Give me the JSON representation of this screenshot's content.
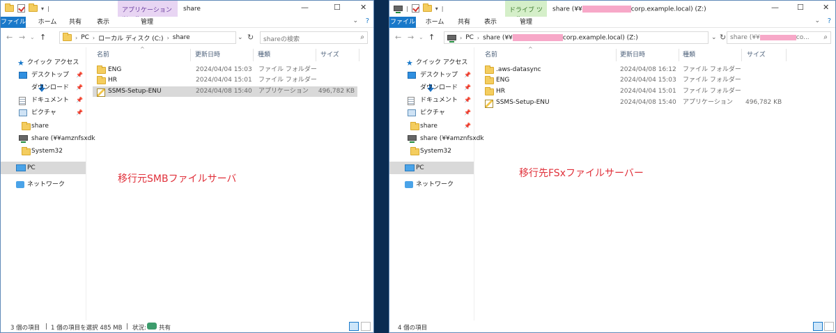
{
  "left": {
    "ribbon_tabs": [
      "ファイル",
      "ホーム",
      "共有",
      "表示",
      "管理"
    ],
    "context_tab": "アプリケーション ツール",
    "title": "share",
    "path": [
      "PC",
      "ローカル ディスク (C:)",
      "share"
    ],
    "search_placeholder": "shareの検索",
    "nav": {
      "quick_access": "クイック アクセス",
      "items": [
        "デスクトップ",
        "ダウンロード",
        "ドキュメント",
        "ピクチャ",
        "share",
        "share (¥¥amznfsxdk",
        "System32"
      ],
      "pc": "PC",
      "network": "ネットワーク"
    },
    "columns": [
      "名前",
      "更新日時",
      "種類",
      "サイズ"
    ],
    "files": [
      {
        "name": "ENG",
        "date": "2024/04/04 15:03",
        "type": "ファイル フォルダー",
        "size": "",
        "icon": "folder-icon"
      },
      {
        "name": "HR",
        "date": "2024/04/04 15:01",
        "type": "ファイル フォルダー",
        "size": "",
        "icon": "folder-icon"
      },
      {
        "name": "SSMS-Setup-ENU",
        "date": "2024/04/08 15:40",
        "type": "アプリケーション",
        "size": "496,782 KB",
        "icon": "application-icon",
        "selected": true
      }
    ],
    "annotation": "移行元SMBファイルサーバ",
    "status": {
      "count": "3 個の項目",
      "selection": "1 個の項目を選択  485 MB",
      "state_label": "状況:",
      "state_value": "共有"
    }
  },
  "right": {
    "ribbon_tabs": [
      "ファイル",
      "ホーム",
      "共有",
      "表示",
      "管理"
    ],
    "context_tab": "ドライブ ツール",
    "title_prefix": "share (¥¥",
    "title_suffix": "corp.example.local) (Z:)",
    "path_prefix": "share (¥¥",
    "path_suffix": "corp.example.local) (Z:)",
    "search_prefix": "share (¥¥",
    "search_suffix": "co...",
    "nav": {
      "quick_access": "クイック アクセス",
      "items": [
        "デスクトップ",
        "ダウンロード",
        "ドキュメント",
        "ピクチャ",
        "share",
        "share (¥¥amznfsxdk",
        "System32"
      ],
      "pc": "PC",
      "network": "ネットワーク"
    },
    "columns": [
      "名前",
      "更新日時",
      "種類",
      "サイズ"
    ],
    "files": [
      {
        "name": ".aws-datasync",
        "date": "2024/04/08 16:12",
        "type": "ファイル フォルダー",
        "size": "",
        "icon": "folder-icon"
      },
      {
        "name": "ENG",
        "date": "2024/04/04 15:03",
        "type": "ファイル フォルダー",
        "size": "",
        "icon": "folder-icon"
      },
      {
        "name": "HR",
        "date": "2024/04/04 15:01",
        "type": "ファイル フォルダー",
        "size": "",
        "icon": "folder-icon"
      },
      {
        "name": "SSMS-Setup-ENU",
        "date": "2024/04/08 15:40",
        "type": "アプリケーション",
        "size": "496,782 KB",
        "icon": "application-icon"
      }
    ],
    "annotation": "移行先FSxファイルサーバー",
    "status": {
      "count": "4 個の項目"
    }
  },
  "colors": {
    "file_tab": "#1979ca",
    "app_tools": "#e8d5f3",
    "drive_tools": "#d5efc9",
    "annotation": "#e0303a",
    "redaction": "#f7a8c8"
  }
}
